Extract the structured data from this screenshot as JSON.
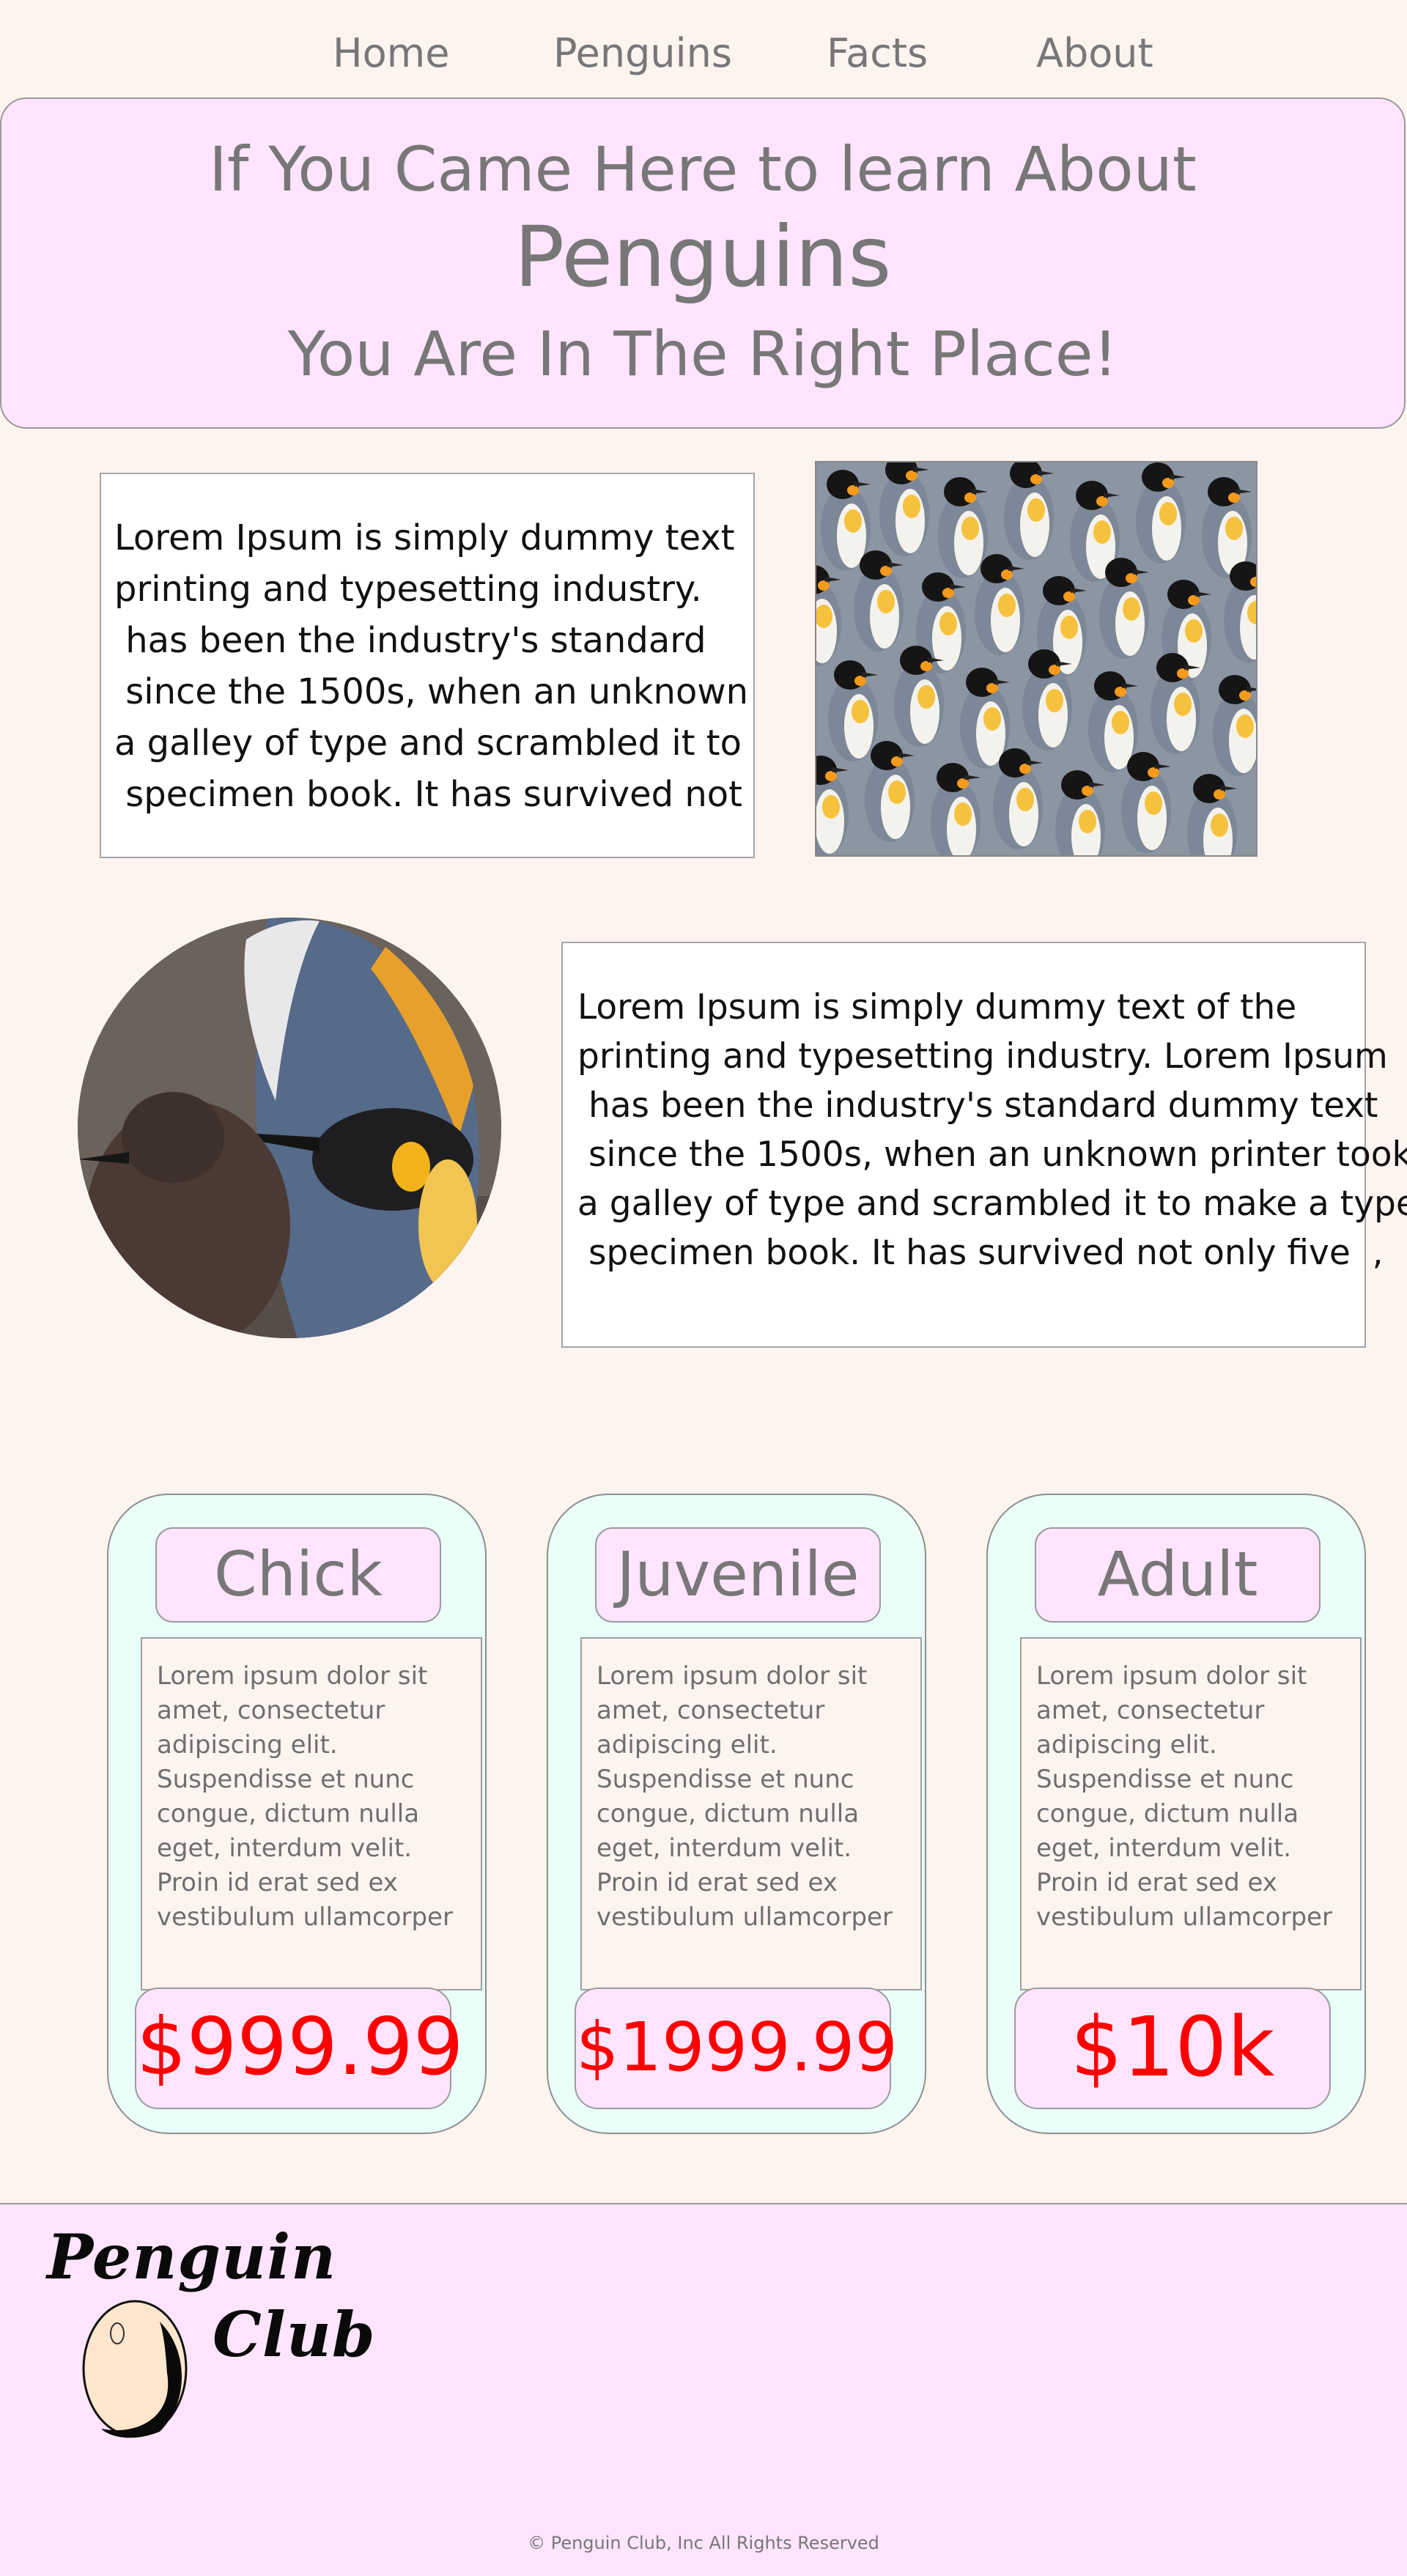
{
  "nav": {
    "items": [
      {
        "label": "Home"
      },
      {
        "label": "Penguins"
      },
      {
        "label": "Facts"
      },
      {
        "label": "About"
      }
    ]
  },
  "hero": {
    "line1": "If You Came Here to learn About",
    "line2": "Penguins",
    "line3": "You Are In The Right Place!"
  },
  "intro_text": {
    "lines": [
      "Lorem Ipsum is simply dummy text",
      "printing and typesetting industry.",
      " has been the industry's standard",
      " since the 1500s, when an unknown",
      "a galley of type and scrambled it to",
      " specimen book. It has survived not"
    ]
  },
  "second_text": {
    "lines": [
      "Lorem Ipsum is simply dummy text of the",
      "printing and typesetting industry. Lorem Ipsum",
      " has been the industry's standard dummy text",
      " since the 1500s, when an unknown printer took",
      "a galley of type and scrambled it to make a type",
      " specimen book. It has survived not only five  ,"
    ]
  },
  "cards": [
    {
      "title": "Chick",
      "desc_lines": [
        "Lorem ipsum dolor sit",
        "amet, consectetur",
        "adipiscing elit.",
        "Suspendisse et nunc",
        "congue, dictum nulla",
        "eget, interdum velit.",
        "Proin id erat sed ex",
        "vestibulum ullamcorper"
      ],
      "price": "$999.99"
    },
    {
      "title": "Juvenile",
      "desc_lines": [
        "Lorem ipsum dolor sit",
        "amet, consectetur",
        "adipiscing elit.",
        "Suspendisse et nunc",
        "congue, dictum nulla",
        "eget, interdum velit.",
        "Proin id erat sed ex",
        "vestibulum ullamcorper"
      ],
      "price": "$1999.99"
    },
    {
      "title": "Adult",
      "desc_lines": [
        "Lorem ipsum dolor sit",
        "amet, consectetur",
        "adipiscing elit.",
        "Suspendisse et nunc",
        "congue, dictum nulla",
        "eget, interdum velit.",
        "Proin id erat sed ex",
        "vestibulum ullamcorper"
      ],
      "price": "$10k"
    }
  ],
  "footer": {
    "logo_word1": "Penguin",
    "logo_word2": "Club",
    "copyright": "© Penguin Club, Inc All Rights Reserved"
  },
  "colors": {
    "page_background": "#fdf4ef",
    "pink_panel": "#ffe4fe",
    "card_background": "#e9fff7",
    "price_red": "#ff0000"
  }
}
